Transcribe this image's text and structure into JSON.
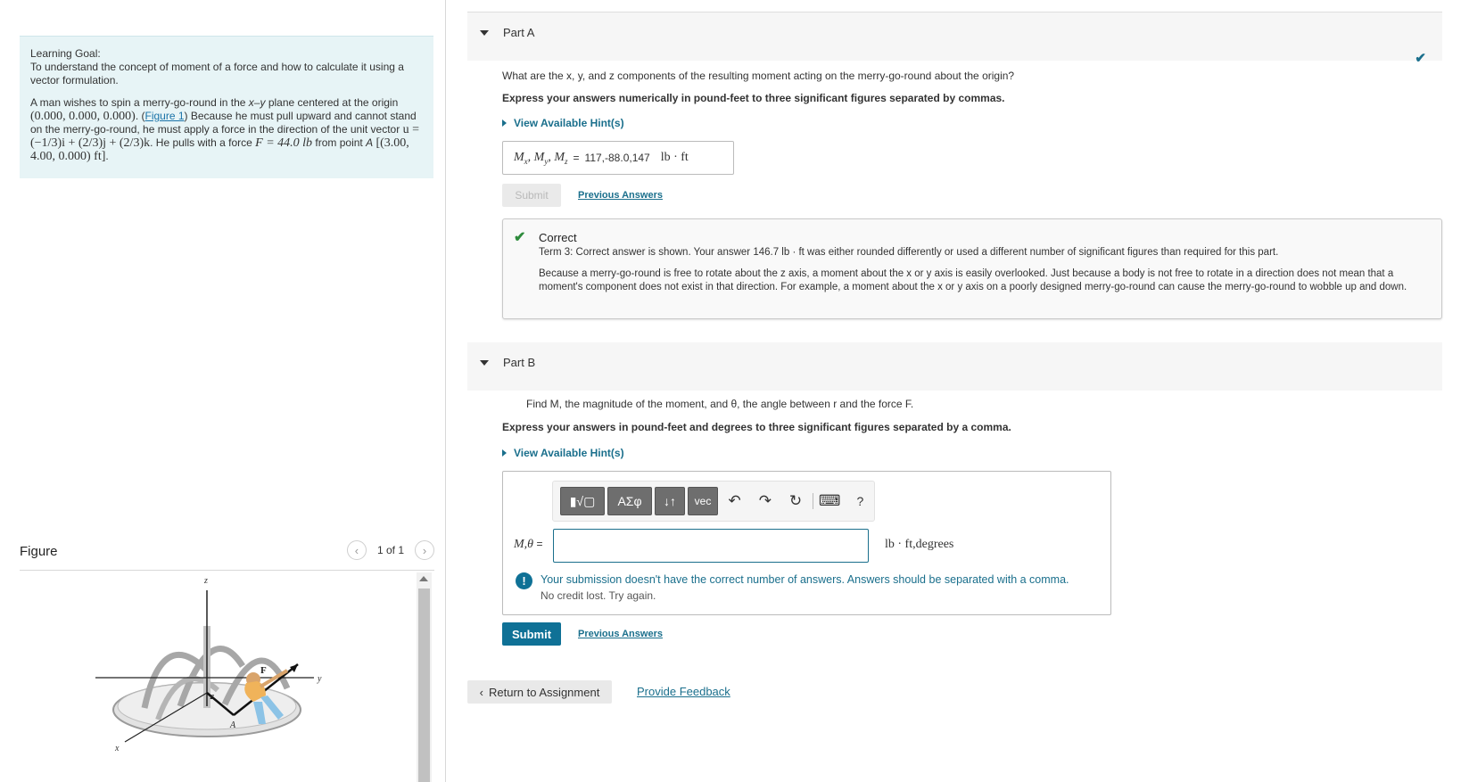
{
  "learning_goal": {
    "title": "Learning Goal:",
    "text": "To understand the concept of moment of a force and how to calculate it using a vector formulation.",
    "problem_p1": "A man wishes to spin a merry-go-round in the",
    "plane_label": "x–y",
    "problem_p2": "plane centered at the origin",
    "origin": "(0.000, 0.000, 0.000)",
    "figure_link": "Figure 1",
    "problem_p3": "Because he must pull upward and cannot stand on the merry-go-round, he must apply a force in the direction of the unit vector",
    "unit_vector": "u = (−1/3)i + (2/3)j + (2/3)k",
    "problem_p4": "He pulls with a force",
    "force": "F = 44.0 lb",
    "problem_p5": "from point",
    "point_label": "A",
    "point": "[(3.00, 4.00, 0.000) ft]"
  },
  "figure": {
    "title": "Figure",
    "counter": "1 of 1",
    "prev_icon": "‹",
    "next_icon": "›",
    "axis_z": "z",
    "axis_y": "y",
    "axis_x": "x",
    "label_F": "F",
    "label_r": "r",
    "label_A": "A"
  },
  "part_a": {
    "label": "Part A",
    "question": "What are the x, y, and z components of the resulting moment acting on the merry-go-round about the origin?",
    "instruction": "Express your answers numerically in pound-feet to three significant figures separated by commas.",
    "hint": "View Available Hint(s)",
    "answer_lhs": "Mx, My, Mz =",
    "answer_value": "117,-88.0,147",
    "answer_unit": "lb · ft",
    "submit": "Submit",
    "previous_answers": "Previous Answers",
    "feedback_title": "Correct",
    "feedback_line1": "Term 3: Correct answer is shown. Your answer 146.7 lb · ft was either rounded differently or used a different number of significant figures than required for this part.",
    "feedback_line2": "Because a merry-go-round is free to rotate about the z axis, a moment about the x or y axis is easily overlooked. Just because a body is not free to rotate in a direction does not mean that a moment's component does not exist in that direction. For example, a moment about the x or y axis on a poorly designed merry-go-round can cause the merry-go-round to wobble up and down."
  },
  "part_b": {
    "label": "Part B",
    "question": "Find M, the magnitude of the moment, and θ, the angle between r and the force F.",
    "instruction": "Express your answers in pound-feet and degrees to three significant figures separated by a comma.",
    "hint": "View Available Hint(s)",
    "toolbar": {
      "templates": "▮√▢",
      "greek": "AΣφ",
      "arrows": "↓↑",
      "vec": "vec",
      "undo": "↶",
      "redo": "↷",
      "reset": "↻",
      "keyboard": "⌨",
      "help": "?"
    },
    "input_lhs": "M,θ",
    "input_eq": "=",
    "input_value": "",
    "input_unit": "lb · ft,degrees",
    "warning": "Your submission doesn't have the correct number of answers. Answers should be separated with a comma.",
    "warning_sub": "No credit lost. Try again.",
    "submit": "Submit",
    "previous_answers": "Previous Answers"
  },
  "footer": {
    "return": "Return to Assignment",
    "feedback": "Provide Feedback"
  }
}
